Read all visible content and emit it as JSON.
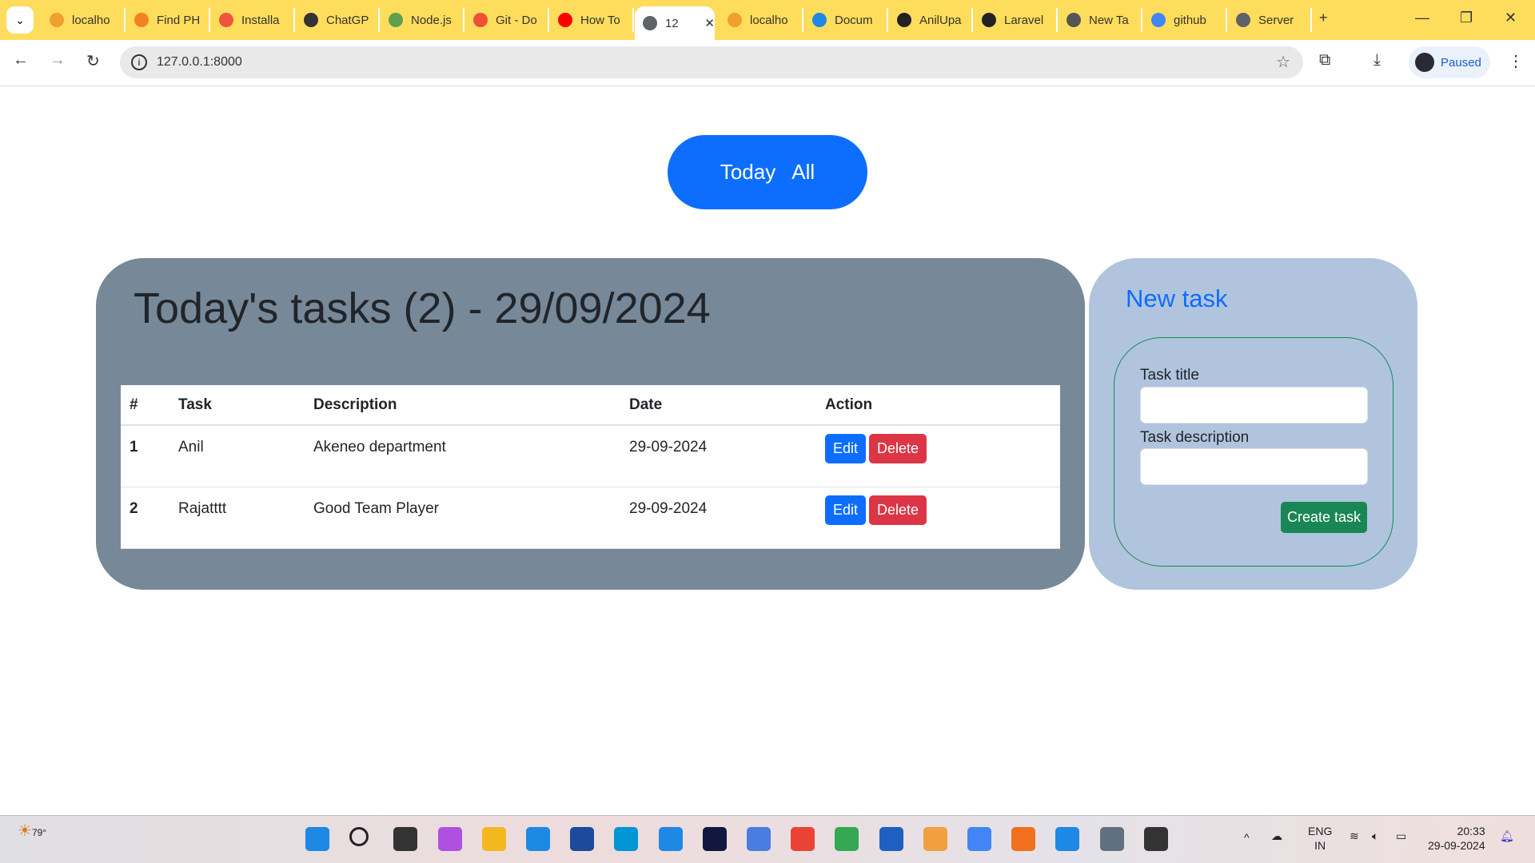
{
  "browser": {
    "tabs": [
      {
        "label": "localho",
        "icon": "phpmyadmin-icon",
        "color": "#f0a030"
      },
      {
        "label": "Find PH",
        "icon": "stackoverflow-icon",
        "color": "#f48024"
      },
      {
        "label": "Installa",
        "icon": "laravel-icon",
        "color": "#f05340"
      },
      {
        "label": "ChatGP",
        "icon": "chatgpt-icon",
        "color": "#333333"
      },
      {
        "label": "Node.js",
        "icon": "nodejs-icon",
        "color": "#5fa04e"
      },
      {
        "label": "Git - Do",
        "icon": "git-icon",
        "color": "#f05033"
      },
      {
        "label": "How To",
        "icon": "youtube-icon",
        "color": "#ff0000"
      },
      {
        "label": "12",
        "icon": "globe-icon",
        "color": "#5f6368",
        "active": true
      },
      {
        "label": "localho",
        "icon": "phpmyadmin-icon",
        "color": "#f0a030"
      },
      {
        "label": "Docum",
        "icon": "vscode-icon",
        "color": "#1e88e5"
      },
      {
        "label": "AnilUpa",
        "icon": "github-icon",
        "color": "#222222"
      },
      {
        "label": "Laravel",
        "icon": "github-icon",
        "color": "#222222"
      },
      {
        "label": "New Ta",
        "icon": "chrome-icon",
        "color": "#555555"
      },
      {
        "label": "github",
        "icon": "google-icon",
        "color": "#4285f4"
      },
      {
        "label": "Server",
        "icon": "globe-icon",
        "color": "#5f6368"
      }
    ],
    "url": "127.0.0.1:8000",
    "profile_label": "Paused"
  },
  "toggle": {
    "today": "Today",
    "all": "All"
  },
  "tasks": {
    "title": "Today's tasks (2) - 29/09/2024",
    "columns": [
      "#",
      "Task",
      "Description",
      "Date",
      "Action"
    ],
    "rows": [
      {
        "num": "1",
        "task": "Anil",
        "description": "Akeneo department",
        "date": "29-09-2024"
      },
      {
        "num": "2",
        "task": "Rajatttt",
        "description": "Good Team Player",
        "date": "29-09-2024"
      }
    ],
    "edit_label": "Edit",
    "delete_label": "Delete"
  },
  "new_task": {
    "title": "New task",
    "title_label": "Task title",
    "title_value": "",
    "description_label": "Task description",
    "description_value": "",
    "submit_label": "Create task"
  },
  "taskbar": {
    "weather": "79°",
    "lang": "ENG",
    "region": "IN",
    "time": "20:33",
    "date": "29-09-2024",
    "apps": [
      "windows-start-icon",
      "search-icon",
      "task-view-icon",
      "copilot-icon",
      "file-explorer-icon",
      "edge-icon",
      "store-icon",
      "myhp-icon",
      "help-icon",
      "dh-icon",
      "translate-icon",
      "google-icon",
      "maps-icon",
      "people-icon",
      "gemini-icon",
      "chrome-icon",
      "xampp-icon",
      "vscode-icon",
      "settings-icon",
      "terminal-icon"
    ]
  },
  "colors": {
    "accent": "#0d6efd",
    "danger": "#dc3545",
    "success": "#198754",
    "card_left": "#778899",
    "card_right": "#b0c4de",
    "tabbar": "#ffdd5c"
  }
}
